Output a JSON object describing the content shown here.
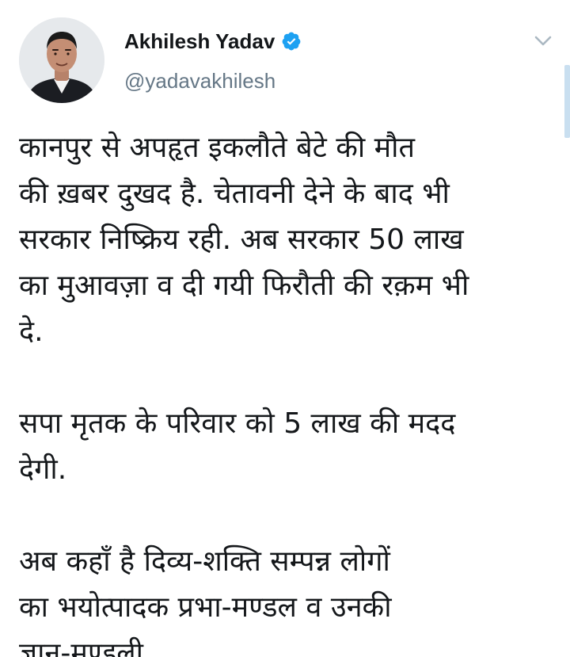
{
  "author": {
    "name": "Akhilesh Yadav",
    "handle": "@yadavakhilesh",
    "verified": true
  },
  "icons": {
    "verified": "verified-badge-icon",
    "menu": "chevron-down-icon"
  },
  "colors": {
    "text": "#14171a",
    "secondary": "#657786",
    "verified": "#1da1f2",
    "scrollbar": "#c9dff0"
  },
  "tweet": {
    "paragraphs": [
      {
        "lines": [
          "कानपुर से अपहृत इकलौते बेटे की मौत",
          "की ख़बर दुखद है. चेतावनी देने के बाद भी",
          "सरकार निष्क्रिय रही. अब सरकार 50 लाख",
          "का मुआवज़ा व दी गयी फिरौती की रक़म भी",
          "दे."
        ]
      },
      {
        "lines": [
          "सपा मृतक के परिवार को 5 लाख की मदद",
          "देगी."
        ]
      },
      {
        "lines": [
          "अब कहाँ है दिव्य-शक्ति सम्पन्न लोगों",
          "का भयोत्पादक प्रभा-मण्डल व उनकी",
          "ज्ञान-मण्डली."
        ]
      }
    ]
  }
}
